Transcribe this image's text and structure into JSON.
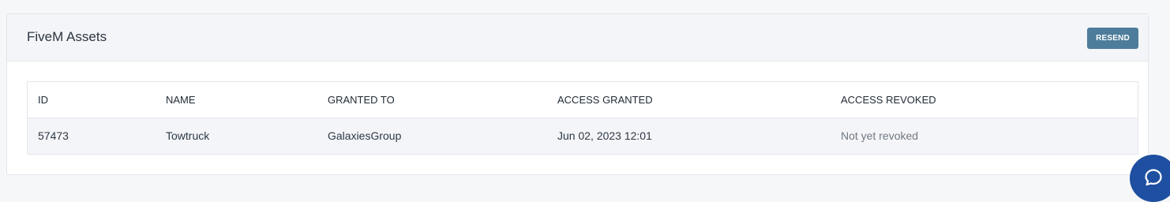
{
  "card": {
    "title": "FiveM Assets",
    "resend_label": "RESEND"
  },
  "table": {
    "columns": [
      "ID",
      "NAME",
      "GRANTED TO",
      "ACCESS GRANTED",
      "ACCESS REVOKED"
    ],
    "rows": [
      {
        "id": "57473",
        "name": "Towtruck",
        "granted_to": "GalaxiesGroup",
        "access_granted": "Jun 02, 2023 12:01",
        "access_revoked": "Not yet revoked"
      }
    ]
  },
  "colors": {
    "resend_button": "#4d7d9a",
    "chat_bubble": "#1e4fa0",
    "header_bg": "#f4f5f8"
  },
  "icons": {
    "chat": "chat-bubble-icon"
  }
}
